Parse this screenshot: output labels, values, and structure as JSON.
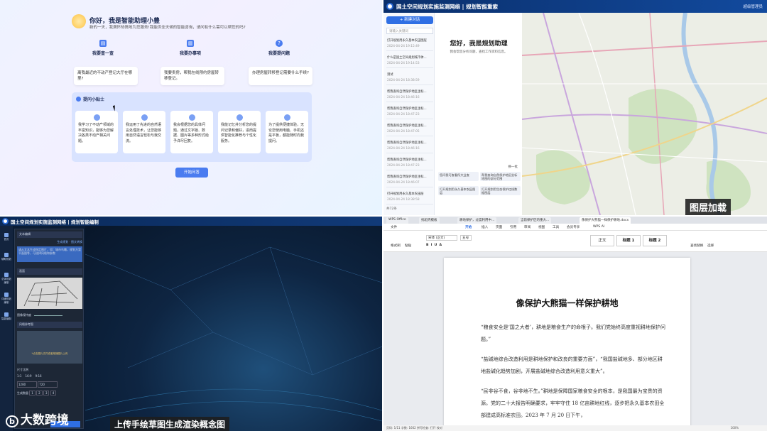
{
  "q1": {
    "greeting": "你好，我是智能助理小豊",
    "sub": "新的一天，我满怀热情地为您服务!我能供全天候的智能咨询，请问有什么需可以帮您的吗?",
    "categories": [
      {
        "icon": "document-icon",
        "label": "我要查一查"
      },
      {
        "icon": "book-icon",
        "label": "我要办事项"
      },
      {
        "icon": "question-icon",
        "label": "我要提问题"
      }
    ],
    "questions": [
      "离我最近的不动产登记大厅在哪里?",
      "我要卖房，帮我在线预约房屋转移登记。",
      "办理房屋转移登记需要什么手续?"
    ],
    "tips_title": "提问小贴士",
    "tips": [
      "我学习了不动产领域的丰富知识，能够为您解决各类不动产相关问题。",
      "我运用了先进的自然语言处理技术，让您能够用自然语言轻松与我交流。",
      "我会根据您的具体问题，通过文字版、数据、图片等多种形式给予详尽回复。",
      "我能记忆并分析您的提问记录和偏好，进而提供智能化推荐与个性化服务。",
      "为了提供便捷体验，无论您使用电脑、手机还是平板，都能随时向我提问。"
    ],
    "start_button": "开始问答"
  },
  "q2": {
    "app_title": "国土空间规划实施监测网络 | 规划智能重索",
    "user": "超级管理员",
    "new_chat": "+ 新建对话",
    "search_placeholder": "请输入关键词",
    "history": [
      {
        "title": "打开规划用永久基本农田图层",
        "date": "2024-04-24 19:15:49"
      },
      {
        "title": "什么是国土空间规划城市体...",
        "date": "2024-04-24 19:14:53"
      },
      {
        "title": "测试",
        "date": "2024-04-24 18:38:59"
      },
      {
        "title": "帮我查询自然保护地区坐标...",
        "date": "2024-04-24 18:46:16"
      },
      {
        "title": "帮我查询自然保护地区坐标...",
        "date": "2024-04-24 18:47:23"
      },
      {
        "title": "帮我查询自然保护地区坐标...",
        "date": "2024-04-24 18:47:05"
      },
      {
        "title": "帮我查询自然保护地区坐标...",
        "date": "2024-04-24 18:46:16"
      },
      {
        "title": "帮我查询自然保护地区坐标...",
        "date": "2024-04-24 18:47:23"
      },
      {
        "title": "帮我查询自然保护地区坐标...",
        "date": "2024-04-24 18:46:07"
      },
      {
        "title": "打开规划用永久基本农田层",
        "date": "2024-04-24 18:38:58"
      }
    ],
    "total": "共72条",
    "hello": "您好，我是规划助理",
    "hello_sub": "我会帮您分析问题，查找工作资料信息。",
    "new_topic": "换一批",
    "suggestions": [
      "您问我可查看所大业查",
      "帮我查询自然保护地区坐标地图的部分范围",
      "打开规划用永久基本农田图层",
      "打开规划用生态保护红线数据图层"
    ],
    "overlay_caption": "图层加载"
  },
  "q3": {
    "app_title": "国土空间规划实施监测网络 | 规划智能编制",
    "nav": [
      "首页",
      "辅助规划",
      "总体规划编制",
      "详细规划编制",
      "智能编制"
    ],
    "panel": {
      "section1": "文本编辑",
      "links": "生成规划 · 图文转换",
      "prompt": "请从文本生成指定图片，如：城市鸟瞰，规划方案平面图等，可选择风格和参数",
      "style_label": "画面",
      "slider_label": "图像保持度",
      "section2": "风格参考图",
      "upload_hint": "*点击图片文件或者拖拽图片上传",
      "size_label": "尺寸比例",
      "sizes": [
        "1:1",
        "16:9",
        "9:16"
      ],
      "dims": [
        "1280",
        "720"
      ],
      "count_label": "生成数量",
      "counts": [
        "1",
        "2",
        "3",
        "4"
      ],
      "button": "生成"
    },
    "caption": "上传手绘草图生成渲染概念图",
    "brand": "大数跨境"
  },
  "q4": {
    "tabs": [
      "WPS Office",
      "找稻壳模板",
      "耕地保护，过度利用中...",
      "当前保护区的重大...",
      "像保护大熊猫一样保护耕地.docx"
    ],
    "menu": [
      "文件",
      "开始",
      "插入",
      "页面",
      "引用",
      "审阅",
      "视图",
      "工具",
      "会员专享",
      "WPS AI"
    ],
    "ribbon": [
      "格式刷",
      "粘贴",
      "宋体 (正文)",
      "五号",
      "正文",
      "标题 1",
      "标题 2",
      "查找替换",
      "选择"
    ],
    "doc_title": "像保护大熊猫一样保护耕地",
    "paragraphs": [
      "“粮食安全是‘国之大者’，耕地是粮食生产的命根子。我们党始终高度重视耕地保护问题。”",
      "“盐碱地综合改造利用是耕地保护和改良的重要方面”，“我国盐碱地多、部分地区耕地盐碱化趋势加剧，开展盐碱地综合改造利用意义重大”。",
      "“民非谷不食，谷非地不生。”耕地是保障国家粮食安全的根本，是我国最为宝贵的资源。党的二十大报告明确要求，牢牢守住 18 亿亩耕地红线，逐步把永久基本农田全部建成高标准农田。2023 年 7 月 20 日下午，"
    ],
    "status": "页码: 1/11    字数: 1662    拼写检查: 打开    校对",
    "zoom": "100%"
  }
}
